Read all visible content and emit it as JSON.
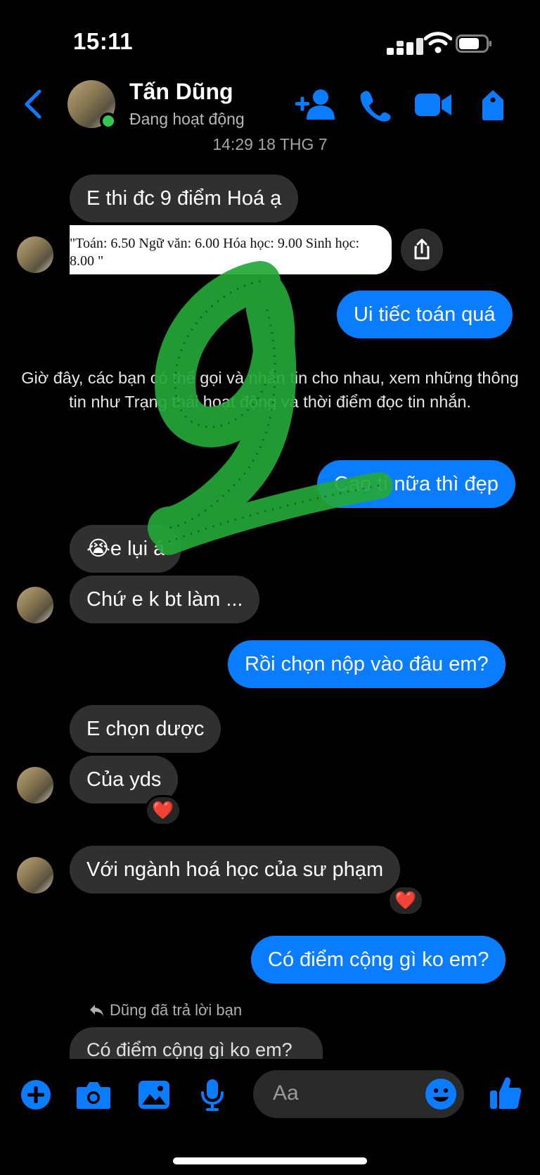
{
  "status_bar": {
    "time": "15:11"
  },
  "header": {
    "contact_name": "Tấn Dũng",
    "contact_status": "Đang hoạt động"
  },
  "thread": {
    "timestamp": "14:29 18 THG 7",
    "messages": [
      {
        "from": "them",
        "text": "E thi đc 9 điểm Hoá ạ"
      },
      {
        "from": "them",
        "type": "document",
        "text": "\"Toán: 6.50 Ngữ văn: 6.00 Hóa học: 9.00 Sinh học: 8.00 \""
      },
      {
        "from": "me",
        "text": "Ui tiếc toán quá"
      },
      {
        "from": "me",
        "text": "Cao tí nữa thì đẹp"
      },
      {
        "from": "them",
        "text": "😭e lụi á"
      },
      {
        "from": "them",
        "text": "Chứ e k bt làm ..."
      },
      {
        "from": "me",
        "text": "Rồi chọn nộp vào đâu em?"
      },
      {
        "from": "them",
        "text": "E chọn dược"
      },
      {
        "from": "them",
        "text": "Của yds",
        "reaction": "❤️"
      },
      {
        "from": "them",
        "text": "Với ngành hoá học của sư phạm",
        "reaction": "❤️"
      },
      {
        "from": "me",
        "text": "Có điểm cộng gì ko em?"
      }
    ],
    "system_notice": "Giờ đây, các bạn có thể gọi và nhắn tin cho nhau, xem những thông tin như Trạng thái hoạt động và thời điểm đọc tin nhắn.",
    "reply_note": "Dũng đã trả lời bạn",
    "reply_quote": "Có điểm cộng gì ko em?"
  },
  "composer": {
    "placeholder": "Aa"
  },
  "colors": {
    "accent": "#0a7cff",
    "incoming_bubble": "#303030",
    "online": "#35c755",
    "overlay_green": "#29b03a"
  }
}
